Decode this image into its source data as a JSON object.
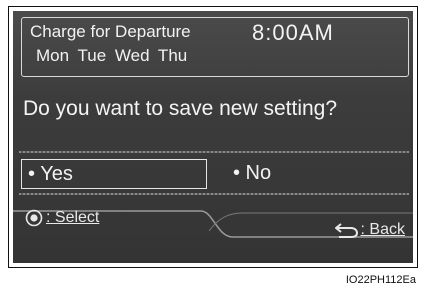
{
  "schedule": {
    "title": "Charge for Departure",
    "time": "8:00AM",
    "days": "Mon  Tue  Wed  Thu"
  },
  "dialog": {
    "question": "Do you want to save new setting?",
    "yes_label": "• Yes",
    "no_label": "• No"
  },
  "footer": {
    "select_label": ": Select",
    "back_label": ": Back"
  },
  "caption": "IO22PH112Ea",
  "icons": {
    "select": "dial-select-icon",
    "back": "back-arrow-icon"
  }
}
